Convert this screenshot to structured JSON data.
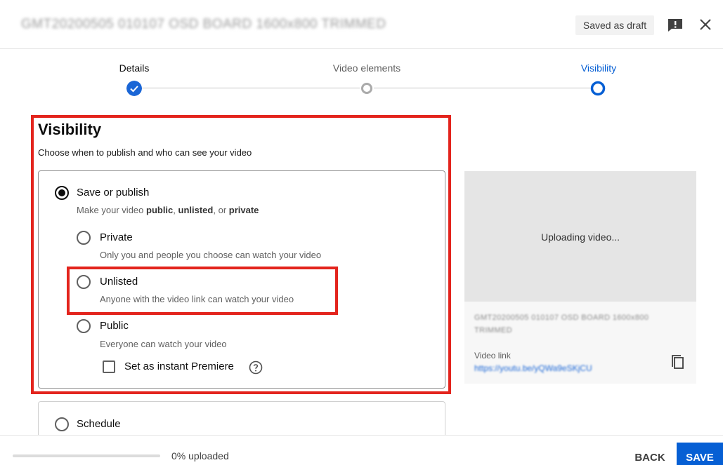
{
  "header": {
    "title": "GMT20200505 010107 OSD BOARD 1600x800 TRIMMED",
    "saved_label": "Saved as draft",
    "feedback_icon": "feedback-icon",
    "close_icon": "close-icon"
  },
  "stepper": {
    "steps": [
      {
        "label": "Details",
        "state": "done"
      },
      {
        "label": "Video elements",
        "state": "pending"
      },
      {
        "label": "Visibility",
        "state": "current"
      }
    ],
    "colors": {
      "accent": "#065fd4",
      "done": "#1a66d6",
      "pending": "#c4c4c4"
    }
  },
  "visibility": {
    "heading": "Visibility",
    "subtitle": "Choose when to publish and who can see your video",
    "save_or_publish": {
      "label": "Save or publish",
      "desc_prefix": "Make your video ",
      "desc_public": "public",
      "desc_sep1": ", ",
      "desc_unlisted": "unlisted",
      "desc_sep2": ", or ",
      "desc_private": "private",
      "selected": true
    },
    "options": [
      {
        "label": "Private",
        "desc": "Only you and people you choose can watch your video"
      },
      {
        "label": "Unlisted",
        "desc": "Anyone with the video link can watch your video"
      },
      {
        "label": "Public",
        "desc": "Everyone can watch your video"
      }
    ],
    "premiere_label": "Set as instant Premiere",
    "schedule_label": "Schedule",
    "highlight_color": "#e3241d"
  },
  "preview": {
    "status": "Uploading video...",
    "filename": "GMT20200505 010107 OSD BOARD 1600x800 TRIMMED",
    "link_label": "Video link",
    "link_url": "https://youtu.be/yQWa9eSKjCU"
  },
  "footer": {
    "progress": 0,
    "upload_text": "0% uploaded",
    "back_label": "BACK",
    "save_label": "SAVE"
  }
}
